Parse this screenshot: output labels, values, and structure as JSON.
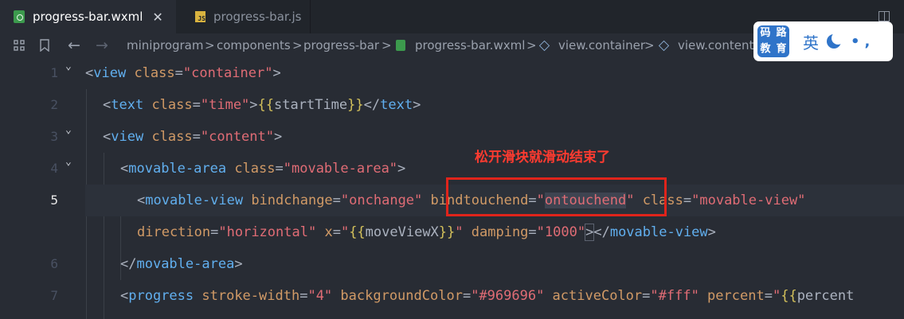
{
  "tabs": [
    {
      "label": "progress-bar.wxml",
      "icon": "wxml-file-icon",
      "active": true,
      "close": "✕"
    },
    {
      "label": "progress-bar.js",
      "icon": "js-file-icon",
      "active": false
    }
  ],
  "js_badge": "JS",
  "breadcrumb": {
    "back": "←",
    "forward": "→",
    "items": [
      "miniprogram",
      "components",
      "progress-bar",
      "progress-bar.wxml",
      "view.container",
      "view.content"
    ],
    "separator": ">"
  },
  "ime": {
    "logo_chars": [
      "码",
      "路",
      "教",
      "育"
    ],
    "lang": "英",
    "dot": "•",
    "comma": ","
  },
  "line_numbers": [
    "1",
    "2",
    "3",
    "4",
    "5",
    "",
    "6",
    "7"
  ],
  "code": {
    "l1": {
      "open": "<",
      "tag": "view",
      "attr": " class",
      "eq": "=",
      "val": "\"container\"",
      "close": ">"
    },
    "l2": {
      "open": "<",
      "tag": "text",
      "attr": " class",
      "eq": "=",
      "val": "\"time\"",
      "gt": ">",
      "b1": "{{",
      "expr": "startTime",
      "b2": "}}",
      "endopen": "</",
      "endtag": "text",
      "endclose": ">"
    },
    "l3": {
      "open": "<",
      "tag": "view",
      "attr": " class",
      "eq": "=",
      "val": "\"content\"",
      "close": ">"
    },
    "l4": {
      "open": "<",
      "tag": "movable-area",
      "attr": " class",
      "eq": "=",
      "val": "\"movable-area\"",
      "close": ">"
    },
    "l5": {
      "open": "<",
      "tag": "movable-view",
      "attr1": " bindchange",
      "eq1": "=",
      "val1": "\"onchange\"",
      "attr2": " bindtouchend",
      "eq2": "=",
      "q1": "\"",
      "val2": "ontouchend",
      "q2": "\"",
      "attr3": " class",
      "eq3": "=",
      "val3": "\"movable-view\""
    },
    "l5b": {
      "attr1": "direction",
      "eq1": "=",
      "val1": "\"horizontal\"",
      "attr2": " x",
      "eq2": "=",
      "q1": "\"",
      "b1": "{{",
      "expr": "moveViewX",
      "b2": "}}",
      "q2": "\"",
      "attr3": " damping",
      "eq3": "=",
      "val3": "\"1000\"",
      "gt": ">",
      "endopen": "</",
      "endtag": "movable-view",
      "endclose": ">"
    },
    "l6": {
      "open": "</",
      "tag": "movable-area",
      "close": ">"
    },
    "l7": {
      "open": "<",
      "tag": "progress",
      "attr1": " stroke-width",
      "eq1": "=",
      "val1": "\"4\"",
      "attr2": " backgroundColor",
      "eq2": "=",
      "val2": "\"#969696\"",
      "attr3": " activeColor",
      "eq3": "=",
      "val3": "\"#fff\"",
      "attr4": " percent",
      "eq4": "=",
      "q": "\"",
      "b1": "{{",
      "expr": "percent"
    }
  },
  "annotation": "松开滑块就滑动结束了",
  "colors": {
    "background": "#282c34",
    "tag": "#e06c75",
    "attribute": "#d19a66",
    "string": "#98c379",
    "annotation": "#ff3b30"
  }
}
